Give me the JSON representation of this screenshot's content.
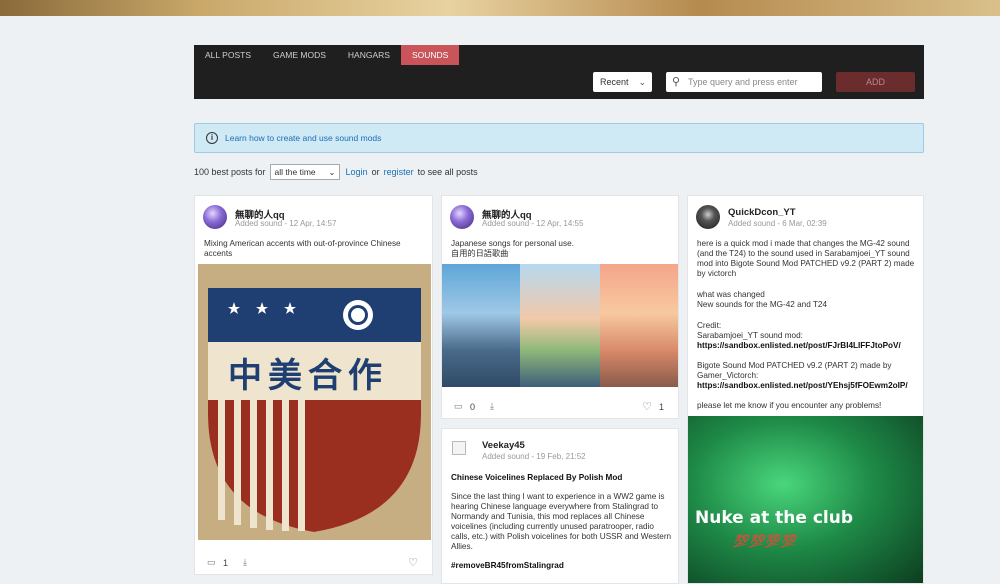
{
  "nav": {
    "tabs": [
      "ALL POSTS",
      "GAME MODS",
      "HANGARS",
      "SOUNDS"
    ],
    "active_tab": "SOUNDS",
    "sort_value": "Recent",
    "search_placeholder": "Type query and press enter",
    "add_label": "ADD"
  },
  "info": {
    "text": "Learn how to create and use sound mods"
  },
  "filter": {
    "prefix": "100 best posts for",
    "period": "all the time",
    "login": "Login",
    "or": "or",
    "register": "register",
    "suffix": "to see all posts"
  },
  "posts": [
    {
      "user": "無聊的人qq",
      "meta": "Added sound - 12 Apr, 14:57",
      "text": "Mixing American accents with out-of-province Chinese accents",
      "image_caption": "中美合作",
      "comments": "1",
      "likes": ""
    },
    {
      "user": "無聊的人qq",
      "meta": "Added sound - 12 Apr, 14:55",
      "text": "Japanese songs for personal use.",
      "text2": "自用的日語歌曲",
      "comments": "0",
      "likes": "1"
    },
    {
      "user": "Veekay45",
      "meta": "Added sound - 19 Feb, 21:52",
      "title": "Chinese Voicelines Replaced By Polish Mod",
      "text": "Since the last thing I want to experience in a WW2 game is hearing Chinese language everywhere from Stalingrad to Normandy and Tunisia, this mod replaces all Chinese voicelines (including currently unused paratrooper, radio calls, etc.) with Polish voicelines for both USSR and Western Allies.",
      "tag": "#removeBR45fromStalingrad"
    },
    {
      "user": "QuickDcon_YT",
      "meta": "Added sound - 6 Mar, 02:39",
      "p1": "here is a quick mod i made that changes the MG-42 sound (and the T24) to the sound used in Sarabamjoei_YT sound mod into Bigote Sound Mod PATCHED v9.2 (PART 2) made by victorch",
      "p2a": "what was changed",
      "p2b": "New sounds for the MG-42 and T24",
      "p3a": "Credit:",
      "p3b": "Sarabamjoei_YT sound mod:",
      "link1": "https://sandbox.enlisted.net/post/FJrBI4LIFFJtoPoV/",
      "p4": "Bigote Sound Mod PATCHED v9.2 (PART 2) made by Gamer_Victorch:",
      "link2": "https://sandbox.enlisted.net/post/YEhsj5fFOEwm2oIP/",
      "p5": "please let me know if you encounter any problems!",
      "image_text": "Nuke at the club",
      "image_sub": "💯💯💯💯"
    }
  ],
  "icons": {
    "info": "info-icon",
    "search": "search-icon",
    "comment": "comment-icon",
    "download": "download-icon",
    "like": "heart-icon"
  }
}
